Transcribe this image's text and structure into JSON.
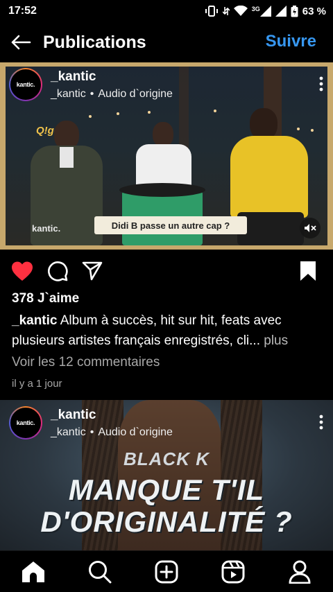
{
  "status_bar": {
    "time": "17:52",
    "network": "3G",
    "battery": "63 %"
  },
  "header": {
    "title": "Publications",
    "follow_label": "Suivre",
    "accent_color": "#3797f0"
  },
  "posts": [
    {
      "username": "_kantic",
      "avatar_text": "kantic.",
      "sub_user": "_kantic",
      "separator": "•",
      "audio": "Audio d`origine",
      "media": {
        "brand": "kantic.",
        "sign_text": "Q!ge",
        "caption_overlay": "Didi B passe un autre cap ?",
        "muted": true
      },
      "liked": true,
      "saved": true,
      "likes": "378 J`aime",
      "caption_user": "_kantic",
      "caption_text": " Album à succès, hit sur hit, feats avec plusieurs artistes français enregistrés, cli...",
      "caption_more": " plus",
      "comments_link": "Voir les 12 commentaires",
      "timestamp": "il y a 1 jour"
    },
    {
      "username": "_kantic",
      "avatar_text": "kantic.",
      "sub_user": "_kantic",
      "separator": "•",
      "audio": "Audio d`origine",
      "media": {
        "overlay_top": "BLACK K",
        "overlay_line1": "MANQUE T'IL",
        "overlay_line2": "D'ORIGINALITÉ ?"
      }
    }
  ],
  "bottom_nav": {
    "items": [
      "home-icon",
      "search-icon",
      "create-icon",
      "reels-icon",
      "profile-icon"
    ]
  },
  "colors": {
    "like_red": "#ff3040",
    "background": "#000000",
    "media_frame": "#c7a86c"
  }
}
